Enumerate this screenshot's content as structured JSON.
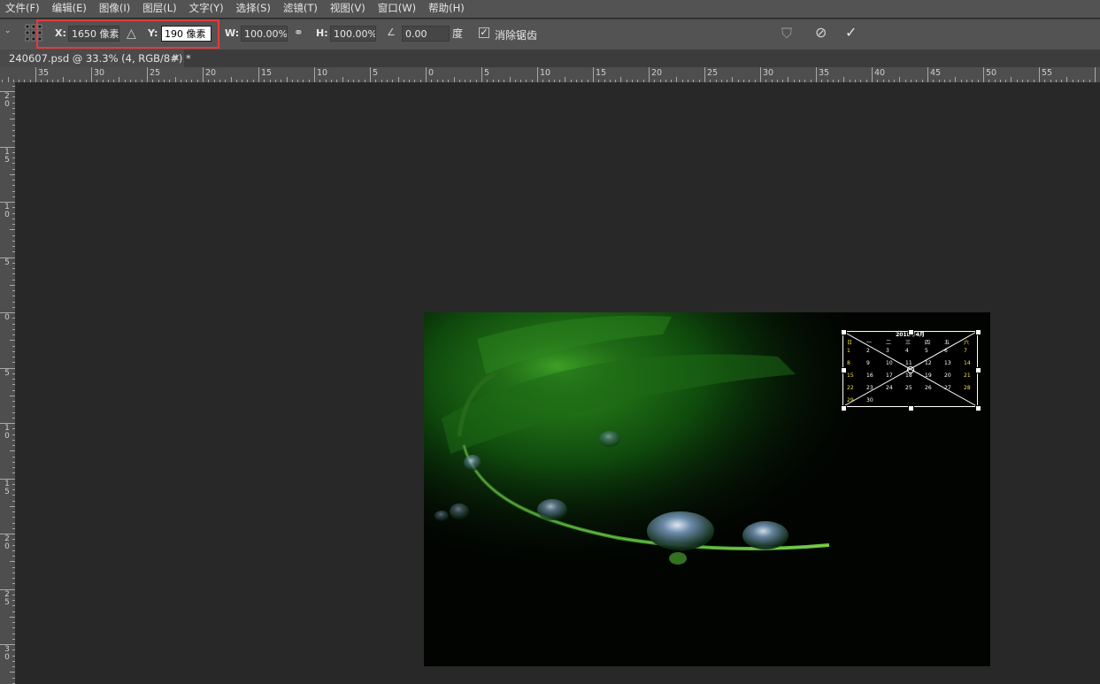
{
  "menu": [
    "文件(F)",
    "编辑(E)",
    "图像(I)",
    "图层(L)",
    "文字(Y)",
    "选择(S)",
    "滤镜(T)",
    "视图(V)",
    "窗口(W)",
    "帮助(H)"
  ],
  "options": {
    "x_label": "X:",
    "x_value": "1650 像素",
    "y_label": "Y:",
    "y_value": "190 像素",
    "w_label": "W:",
    "w_value": "100.00%",
    "h_label": "H:",
    "h_value": "100.00%",
    "angle_value": "0.00",
    "angle_unit": "度",
    "antialias_label": "消除锯齿",
    "antialias_checked": true
  },
  "document": {
    "tab_title": "240607.psd @ 33.3% (4, RGB/8#) *"
  },
  "ruler_top": [
    "35",
    "30",
    "25",
    "20",
    "15",
    "10",
    "5",
    "0",
    "5",
    "10",
    "15",
    "20",
    "25",
    "30",
    "35",
    "40",
    "45",
    "50",
    "55"
  ],
  "ruler_left": [
    "2 0",
    "1 5",
    "1 0",
    "5",
    "0",
    "5",
    "1 0",
    "1 5",
    "2 0",
    "2 5",
    "3 0"
  ],
  "calendar": {
    "title": "2018年4月",
    "weekdays": [
      "日",
      "一",
      "二",
      "三",
      "四",
      "五",
      "六"
    ],
    "days": [
      "1",
      "2",
      "3",
      "4",
      "5",
      "6",
      "7",
      "8",
      "9",
      "10",
      "11",
      "12",
      "13",
      "14",
      "15",
      "16",
      "17",
      "18",
      "19",
      "20",
      "21",
      "22",
      "23",
      "24",
      "25",
      "26",
      "27",
      "28",
      "29",
      "30"
    ]
  },
  "colors": {
    "highlight": "#e33b3b",
    "panel": "#535353",
    "workspace": "#282828"
  }
}
